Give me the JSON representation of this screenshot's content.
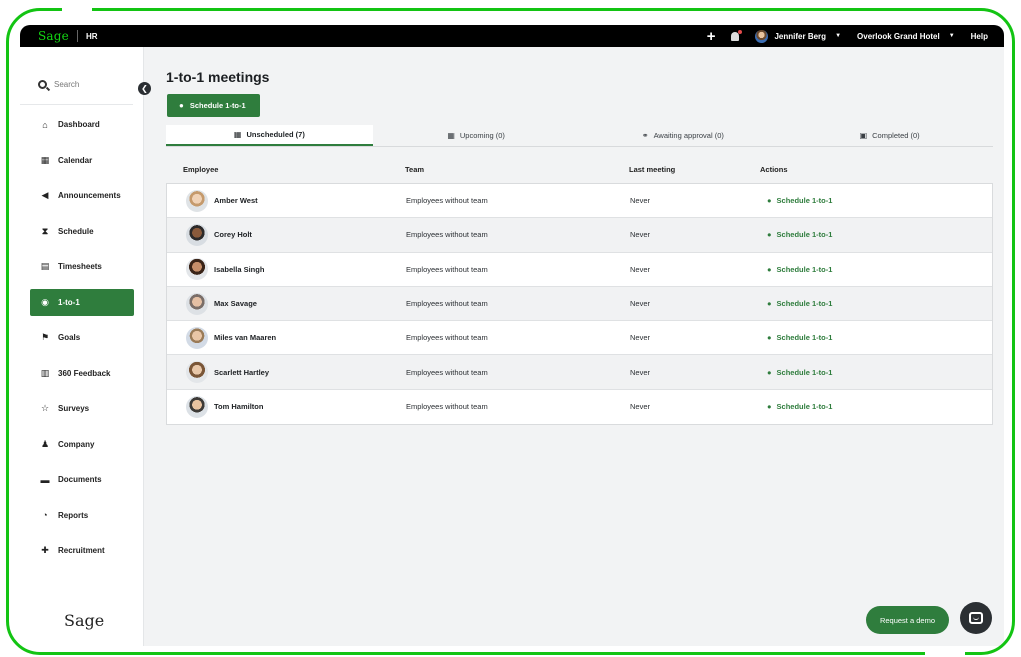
{
  "topbar": {
    "brand": "Sage",
    "product": "HR",
    "user_name": "Jennifer Berg",
    "organization": "Overlook Grand Hotel",
    "help": "Help"
  },
  "sidebar": {
    "search_placeholder": "Search",
    "items": [
      {
        "label": "Dashboard",
        "icon": "home-icon",
        "glyph": "⌂"
      },
      {
        "label": "Calendar",
        "icon": "calendar-icon",
        "glyph": "▦"
      },
      {
        "label": "Announcements",
        "icon": "megaphone-icon",
        "glyph": "◀"
      },
      {
        "label": "Schedule",
        "icon": "hourglass-icon",
        "glyph": "⧗"
      },
      {
        "label": "Timesheets",
        "icon": "table-icon",
        "glyph": "▤"
      },
      {
        "label": "1-to-1",
        "icon": "chat-icon",
        "glyph": "◉"
      },
      {
        "label": "Goals",
        "icon": "flag-icon",
        "glyph": "⚑"
      },
      {
        "label": "360 Feedback",
        "icon": "document-icon",
        "glyph": "▥"
      },
      {
        "label": "Surveys",
        "icon": "star-icon",
        "glyph": "☆"
      },
      {
        "label": "Company",
        "icon": "people-icon",
        "glyph": "♟"
      },
      {
        "label": "Documents",
        "icon": "folder-icon",
        "glyph": "▬"
      },
      {
        "label": "Reports",
        "icon": "pie-chart-icon",
        "glyph": "◔"
      },
      {
        "label": "Recruitment",
        "icon": "add-user-icon",
        "glyph": "✚"
      }
    ],
    "footer_logo": "Sage"
  },
  "main": {
    "title": "1-to-1 meetings",
    "schedule_button": "Schedule 1-to-1",
    "tabs": [
      {
        "label": "Unscheduled (7)",
        "icon": "calendar-icon"
      },
      {
        "label": "Upcoming (0)",
        "icon": "calendar-icon"
      },
      {
        "label": "Awaiting approval (0)",
        "icon": "handshake-icon"
      },
      {
        "label": "Completed (0)",
        "icon": "calendar-check-icon"
      }
    ],
    "table": {
      "headers": [
        "Employee",
        "Team",
        "Last meeting",
        "Actions"
      ],
      "rows": [
        {
          "employee": "Amber West",
          "team": "Employees without team",
          "last": "Never",
          "action": "Schedule 1-to-1"
        },
        {
          "employee": "Corey Holt",
          "team": "Employees without team",
          "last": "Never",
          "action": "Schedule 1-to-1"
        },
        {
          "employee": "Isabella Singh",
          "team": "Employees without team",
          "last": "Never",
          "action": "Schedule 1-to-1"
        },
        {
          "employee": "Max Savage",
          "team": "Employees without team",
          "last": "Never",
          "action": "Schedule 1-to-1"
        },
        {
          "employee": "Miles van Maaren",
          "team": "Employees without team",
          "last": "Never",
          "action": "Schedule 1-to-1"
        },
        {
          "employee": "Scarlett Hartley",
          "team": "Employees without team",
          "last": "Never",
          "action": "Schedule 1-to-1"
        },
        {
          "employee": "Tom Hamilton",
          "team": "Employees without team",
          "last": "Never",
          "action": "Schedule 1-to-1"
        }
      ]
    }
  },
  "request_demo": "Request a demo",
  "colors": {
    "brand_green": "#2f7d3d",
    "frame_green": "#13c413",
    "topbar": "#000000"
  }
}
